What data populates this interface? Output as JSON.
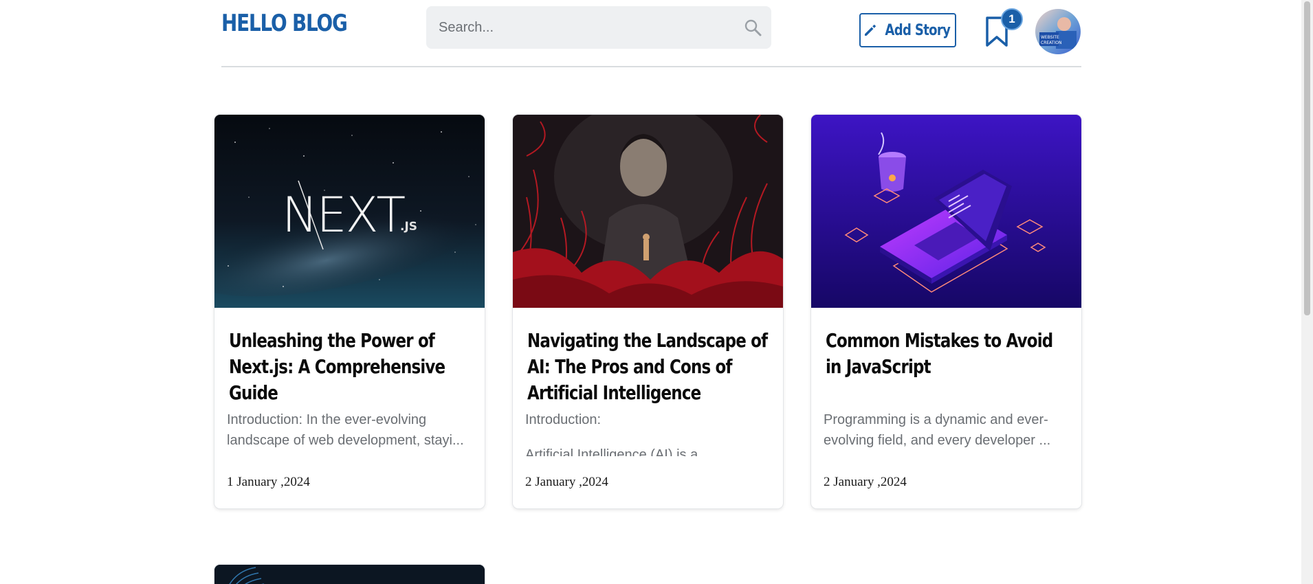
{
  "header": {
    "logo": "HELLO BLOG",
    "search": {
      "placeholder": "Search...",
      "value": ""
    },
    "add_story_label": "Add Story",
    "bookmark_count": "1",
    "avatar_text": "WEBSITE CREATION"
  },
  "colors": {
    "brand": "#1a5fa8",
    "search_bg": "#eef0f2",
    "excerpt_text": "#6a6e73"
  },
  "icons": {
    "search": "search-icon",
    "add_story": "pencil-icon",
    "bookmarks": "bookmark-icon"
  },
  "posts": [
    {
      "title": "Unleashing the Power of Next.js: A Comprehensive Guide",
      "excerpt": [
        "Introduction: In the ever-evolving landscape of web development, stayi..."
      ],
      "date": "1 January ,2024",
      "image_text": [
        "NEXT",
        ".JS"
      ]
    },
    {
      "title": "Navigating the Landscape of AI: The Pros and Cons of Artificial Intelligence",
      "excerpt": [
        "Introduction:",
        "Artificial Intelligence (AI) is a"
      ],
      "date": "2 January ,2024"
    },
    {
      "title": "Common Mistakes to Avoid in JavaScript",
      "excerpt": [
        "Programming is a dynamic and ever-evolving field, and every developer ..."
      ],
      "date": "2 January ,2024"
    }
  ]
}
